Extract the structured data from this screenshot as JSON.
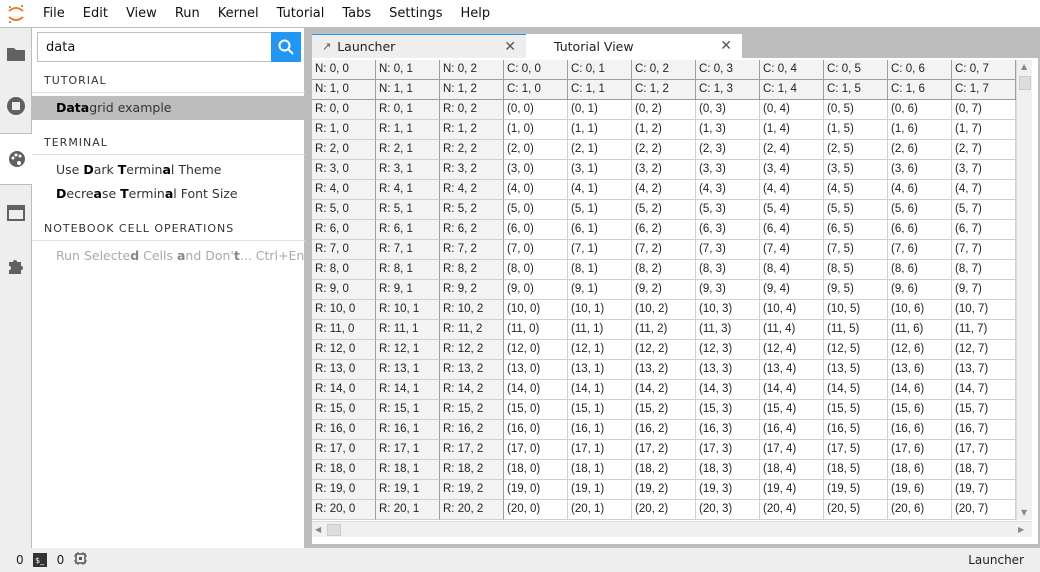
{
  "menu": [
    "File",
    "Edit",
    "View",
    "Run",
    "Kernel",
    "Tutorial",
    "Tabs",
    "Settings",
    "Help"
  ],
  "search": {
    "value": "data"
  },
  "sidebar": {
    "categories": [
      "TUTORIAL",
      "TERMINAL",
      "NOTEBOOK CELL OPERATIONS"
    ],
    "items": [
      {
        "segments": [
          {
            "t": "Data",
            "b": true
          },
          {
            "t": "grid example"
          }
        ]
      },
      {
        "segments": [
          {
            "t": "Use "
          },
          {
            "t": "D",
            "b": true
          },
          {
            "t": "ar"
          },
          {
            "t": "k",
            "b": false
          },
          {
            "t": " "
          },
          {
            "t": "T",
            "b": true
          },
          {
            "t": "ermin"
          },
          {
            "t": "a",
            "b": true
          },
          {
            "t": "l Theme"
          }
        ]
      },
      {
        "segments": [
          {
            "t": "D",
            "b": true
          },
          {
            "t": "ecre"
          },
          {
            "t": "a",
            "b": true
          },
          {
            "t": "se "
          },
          {
            "t": "T",
            "b": true
          },
          {
            "t": "ermin"
          },
          {
            "t": "a",
            "b": true
          },
          {
            "t": "l Font Size"
          }
        ]
      },
      {
        "segments": [
          {
            "t": "Run Selecte"
          },
          {
            "t": "d",
            "b": true
          },
          {
            "t": " Cells "
          },
          {
            "t": "a",
            "b": true
          },
          {
            "t": "nd Don'"
          },
          {
            "t": "t",
            "b": true
          },
          {
            "t": "... Ctrl+Enter"
          }
        ]
      }
    ]
  },
  "tabs": [
    {
      "label": "Launcher"
    },
    {
      "label": "Tutorial View"
    }
  ],
  "grid": {
    "header": [
      [
        "N: 0, 0",
        "N: 0, 1",
        "N: 0, 2",
        "C: 0, 0",
        "C: 0, 1",
        "C: 0, 2",
        "C: 0, 3",
        "C: 0, 4",
        "C: 0, 5",
        "C: 0, 6",
        "C: 0, 7"
      ],
      [
        "N: 1, 0",
        "N: 1, 1",
        "N: 1, 2",
        "C: 1, 0",
        "C: 1, 1",
        "C: 1, 2",
        "C: 1, 3",
        "C: 1, 4",
        "C: 1, 5",
        "C: 1, 6",
        "C: 1, 7"
      ]
    ],
    "rows": [
      [
        "R: 0, 0",
        "R: 0, 1",
        "R: 0, 2",
        "(0, 0)",
        "(0, 1)",
        "(0, 2)",
        "(0, 3)",
        "(0, 4)",
        "(0, 5)",
        "(0, 6)",
        "(0, 7)"
      ],
      [
        "R: 1, 0",
        "R: 1, 1",
        "R: 1, 2",
        "(1, 0)",
        "(1, 1)",
        "(1, 2)",
        "(1, 3)",
        "(1, 4)",
        "(1, 5)",
        "(1, 6)",
        "(1, 7)"
      ],
      [
        "R: 2, 0",
        "R: 2, 1",
        "R: 2, 2",
        "(2, 0)",
        "(2, 1)",
        "(2, 2)",
        "(2, 3)",
        "(2, 4)",
        "(2, 5)",
        "(2, 6)",
        "(2, 7)"
      ],
      [
        "R: 3, 0",
        "R: 3, 1",
        "R: 3, 2",
        "(3, 0)",
        "(3, 1)",
        "(3, 2)",
        "(3, 3)",
        "(3, 4)",
        "(3, 5)",
        "(3, 6)",
        "(3, 7)"
      ],
      [
        "R: 4, 0",
        "R: 4, 1",
        "R: 4, 2",
        "(4, 0)",
        "(4, 1)",
        "(4, 2)",
        "(4, 3)",
        "(4, 4)",
        "(4, 5)",
        "(4, 6)",
        "(4, 7)"
      ],
      [
        "R: 5, 0",
        "R: 5, 1",
        "R: 5, 2",
        "(5, 0)",
        "(5, 1)",
        "(5, 2)",
        "(5, 3)",
        "(5, 4)",
        "(5, 5)",
        "(5, 6)",
        "(5, 7)"
      ],
      [
        "R: 6, 0",
        "R: 6, 1",
        "R: 6, 2",
        "(6, 0)",
        "(6, 1)",
        "(6, 2)",
        "(6, 3)",
        "(6, 4)",
        "(6, 5)",
        "(6, 6)",
        "(6, 7)"
      ],
      [
        "R: 7, 0",
        "R: 7, 1",
        "R: 7, 2",
        "(7, 0)",
        "(7, 1)",
        "(7, 2)",
        "(7, 3)",
        "(7, 4)",
        "(7, 5)",
        "(7, 6)",
        "(7, 7)"
      ],
      [
        "R: 8, 0",
        "R: 8, 1",
        "R: 8, 2",
        "(8, 0)",
        "(8, 1)",
        "(8, 2)",
        "(8, 3)",
        "(8, 4)",
        "(8, 5)",
        "(8, 6)",
        "(8, 7)"
      ],
      [
        "R: 9, 0",
        "R: 9, 1",
        "R: 9, 2",
        "(9, 0)",
        "(9, 1)",
        "(9, 2)",
        "(9, 3)",
        "(9, 4)",
        "(9, 5)",
        "(9, 6)",
        "(9, 7)"
      ],
      [
        "R: 10, 0",
        "R: 10, 1",
        "R: 10, 2",
        "(10, 0)",
        "(10, 1)",
        "(10, 2)",
        "(10, 3)",
        "(10, 4)",
        "(10, 5)",
        "(10, 6)",
        "(10, 7)"
      ],
      [
        "R: 11, 0",
        "R: 11, 1",
        "R: 11, 2",
        "(11, 0)",
        "(11, 1)",
        "(11, 2)",
        "(11, 3)",
        "(11, 4)",
        "(11, 5)",
        "(11, 6)",
        "(11, 7)"
      ],
      [
        "R: 12, 0",
        "R: 12, 1",
        "R: 12, 2",
        "(12, 0)",
        "(12, 1)",
        "(12, 2)",
        "(12, 3)",
        "(12, 4)",
        "(12, 5)",
        "(12, 6)",
        "(12, 7)"
      ],
      [
        "R: 13, 0",
        "R: 13, 1",
        "R: 13, 2",
        "(13, 0)",
        "(13, 1)",
        "(13, 2)",
        "(13, 3)",
        "(13, 4)",
        "(13, 5)",
        "(13, 6)",
        "(13, 7)"
      ],
      [
        "R: 14, 0",
        "R: 14, 1",
        "R: 14, 2",
        "(14, 0)",
        "(14, 1)",
        "(14, 2)",
        "(14, 3)",
        "(14, 4)",
        "(14, 5)",
        "(14, 6)",
        "(14, 7)"
      ],
      [
        "R: 15, 0",
        "R: 15, 1",
        "R: 15, 2",
        "(15, 0)",
        "(15, 1)",
        "(15, 2)",
        "(15, 3)",
        "(15, 4)",
        "(15, 5)",
        "(15, 6)",
        "(15, 7)"
      ],
      [
        "R: 16, 0",
        "R: 16, 1",
        "R: 16, 2",
        "(16, 0)",
        "(16, 1)",
        "(16, 2)",
        "(16, 3)",
        "(16, 4)",
        "(16, 5)",
        "(16, 6)",
        "(16, 7)"
      ],
      [
        "R: 17, 0",
        "R: 17, 1",
        "R: 17, 2",
        "(17, 0)",
        "(17, 1)",
        "(17, 2)",
        "(17, 3)",
        "(17, 4)",
        "(17, 5)",
        "(17, 6)",
        "(17, 7)"
      ],
      [
        "R: 18, 0",
        "R: 18, 1",
        "R: 18, 2",
        "(18, 0)",
        "(18, 1)",
        "(18, 2)",
        "(18, 3)",
        "(18, 4)",
        "(18, 5)",
        "(18, 6)",
        "(18, 7)"
      ],
      [
        "R: 19, 0",
        "R: 19, 1",
        "R: 19, 2",
        "(19, 0)",
        "(19, 1)",
        "(19, 2)",
        "(19, 3)",
        "(19, 4)",
        "(19, 5)",
        "(19, 6)",
        "(19, 7)"
      ],
      [
        "R: 20, 0",
        "R: 20, 1",
        "R: 20, 2",
        "(20, 0)",
        "(20, 1)",
        "(20, 2)",
        "(20, 3)",
        "(20, 4)",
        "(20, 5)",
        "(20, 6)",
        "(20, 7)"
      ]
    ]
  },
  "status": {
    "kernels": "0",
    "terminals": "0",
    "right": "Launcher"
  },
  "colors": {
    "accent": "#2196f3",
    "logo": "#f37726"
  }
}
